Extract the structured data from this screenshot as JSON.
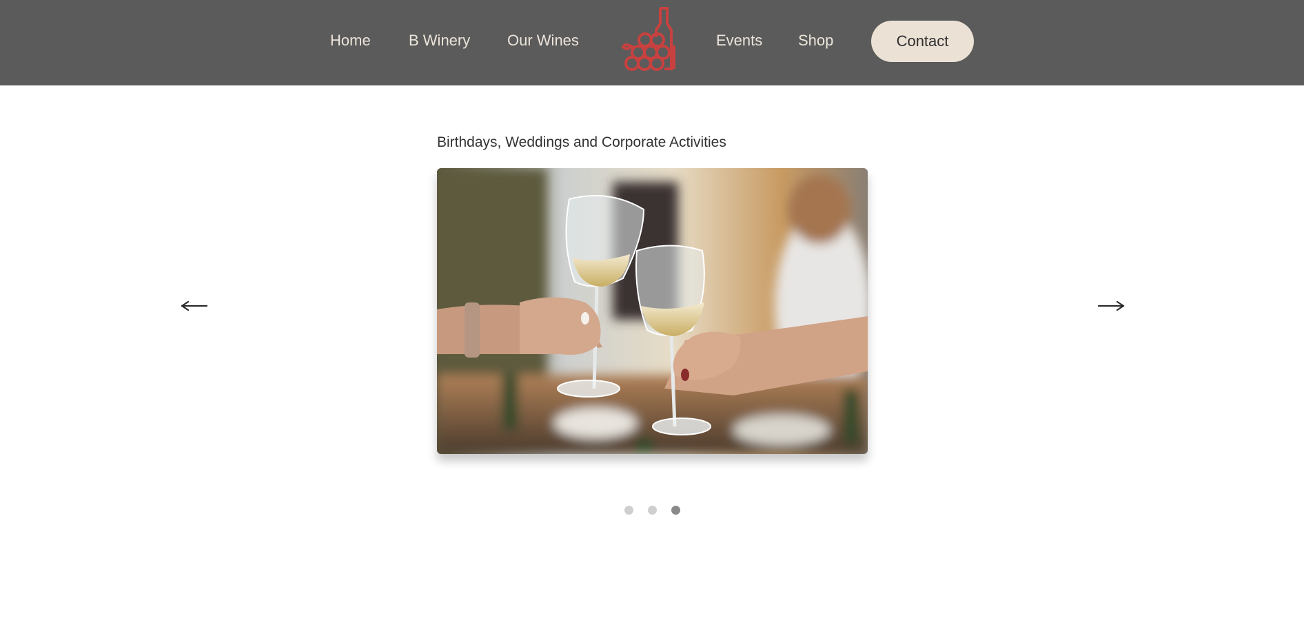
{
  "nav": {
    "left_items": [
      "Home",
      "B Winery",
      "Our Wines"
    ],
    "right_items": [
      "Events",
      "Shop"
    ],
    "contact_label": "Contact",
    "logo_icon": "wine-bottle-grapes-icon",
    "logo_color": "#c9413f",
    "background_color": "#5b5b5b"
  },
  "carousel": {
    "slide_title": "Birthdays, Weddings and Corporate Activities",
    "prev_icon": "arrow-left-icon",
    "next_icon": "arrow-right-icon",
    "slide_count": 3,
    "active_slide": 3
  }
}
